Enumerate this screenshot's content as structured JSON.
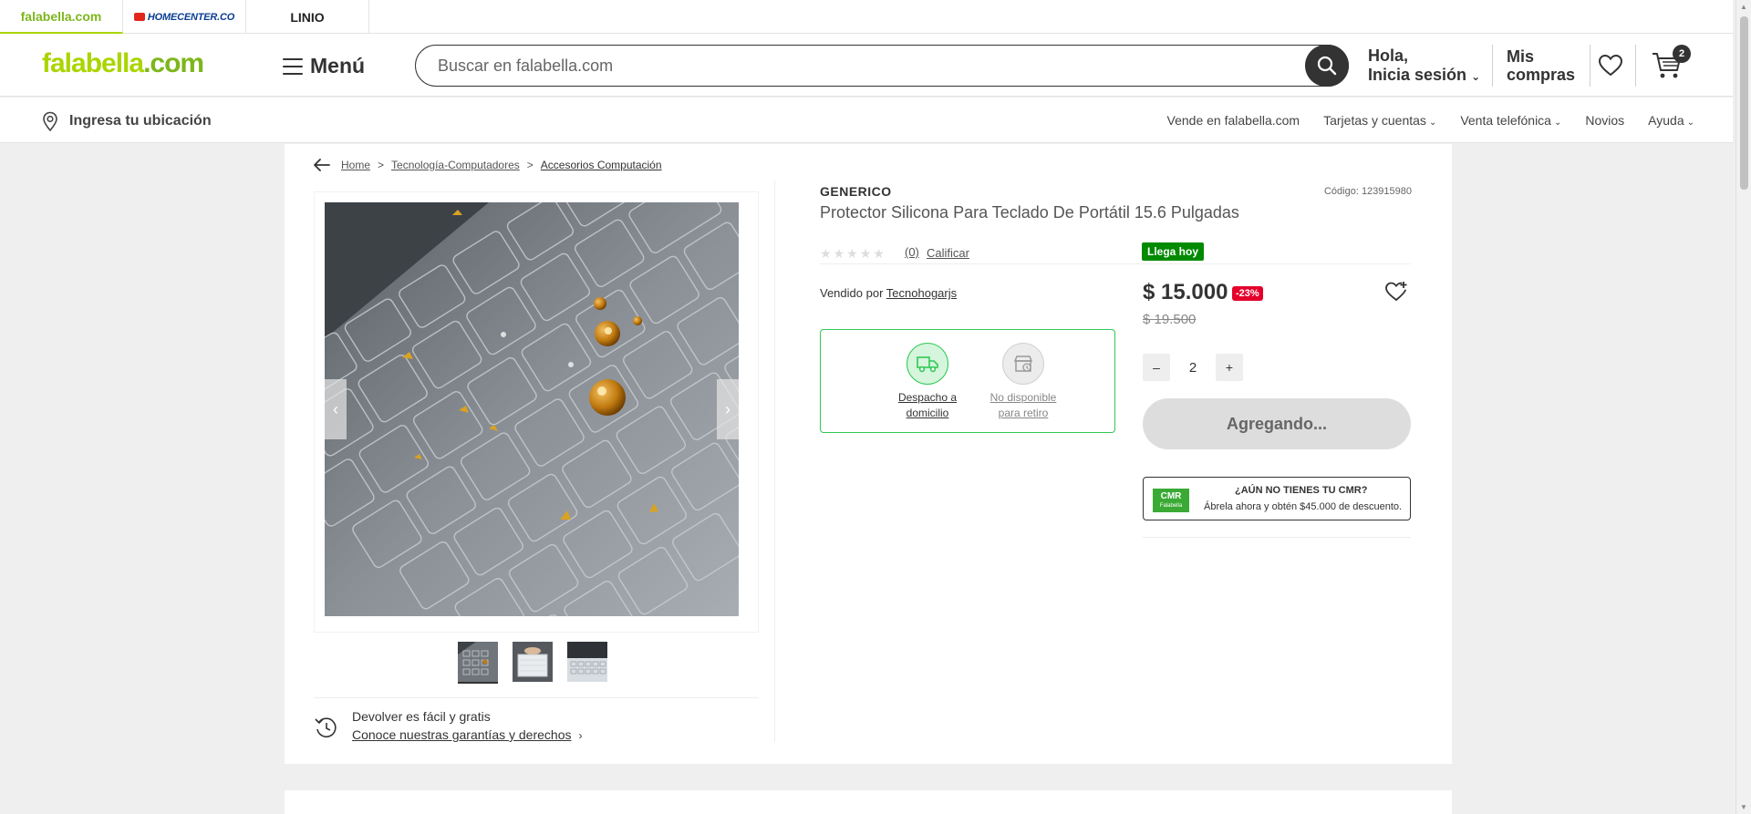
{
  "brands": [
    {
      "label": "falabella.com"
    },
    {
      "label": "HOMECENTER.CO"
    },
    {
      "label": "LINIO"
    }
  ],
  "header": {
    "logo": "falabella",
    "logo_suffix": ".com",
    "menu_label": "Menú",
    "search_placeholder": "Buscar en falabella.com",
    "greeting_line1": "Hola,",
    "greeting_line2": "Inicia sesión",
    "purchases_line1": "Mis",
    "purchases_line2": "compras",
    "cart_count": "2"
  },
  "subheader": {
    "location": "Ingresa tu ubicación",
    "links": [
      "Vende en falabella.com",
      "Tarjetas y cuentas",
      "Venta telefónica",
      "Novios",
      "Ayuda"
    ]
  },
  "breadcrumb": [
    "Home",
    "Tecnología-Computadores",
    "Accesorios Computación"
  ],
  "product": {
    "brand": "GENERICO",
    "code": "Código: 123915980",
    "title": "Protector Silicona Para Teclado De Portátil 15.6 Pulgadas",
    "rating_count": "(0)",
    "rate_label": "Calificar",
    "rating": 0,
    "arrival_badge": "Llega hoy",
    "sold_by_label": "Vendido por",
    "seller": "Tecnohogarjs",
    "price": "$ 15.000",
    "discount": "-23%",
    "old_price": "$ 19.500",
    "quantity": "2",
    "add_button": "Agregando...",
    "qty_minus": "–",
    "qty_plus": "+"
  },
  "delivery": {
    "home_line1": "Despacho a",
    "home_line2": "domicilio",
    "pickup_line1": "No disponible",
    "pickup_line2": "para retiro"
  },
  "cmr": {
    "logo": "CMR",
    "logo_sub": "Falabella",
    "line1": "¿AÚN NO TIENES TU CMR?",
    "line2": "Ábrela ahora y obtén $45.000 de descuento."
  },
  "returns": {
    "line1": "Devolver es fácil y gratis",
    "line2": "Conoce nuestras garantías y derechos"
  },
  "colors": {
    "brand_green": "#aad500",
    "success_green": "#30c954",
    "badge_green": "#008a00",
    "discount_red": "#e4002b"
  }
}
